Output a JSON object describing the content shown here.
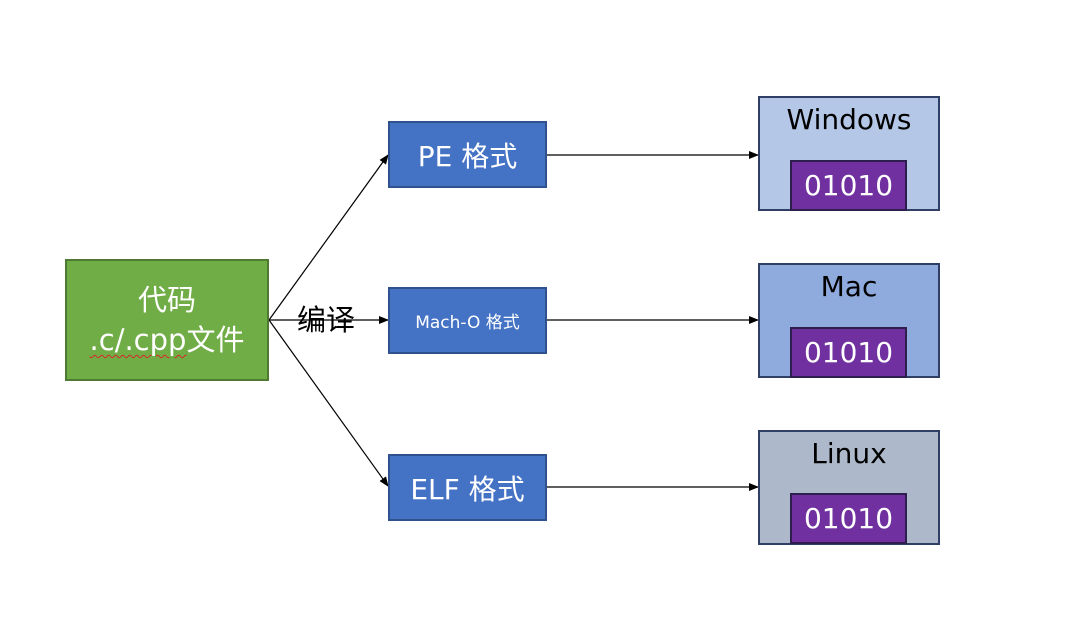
{
  "source": {
    "line1": "代码",
    "line2_ext": ".c/.cpp",
    "line2_suffix": "文件"
  },
  "edge_label": "编译",
  "formats": [
    {
      "label": "PE 格式"
    },
    {
      "label": "Mach-O 格式"
    },
    {
      "label": "ELF 格式"
    }
  ],
  "platforms": [
    {
      "name": "Windows",
      "binary": "01010"
    },
    {
      "name": "Mac",
      "binary": "01010"
    },
    {
      "name": "Linux",
      "binary": "01010"
    }
  ],
  "colors": {
    "source": "#70ad47",
    "format": "#4472c4",
    "windows": "#b4c7e7",
    "mac": "#8faadc",
    "linux": "#adb9ca",
    "binary": "#7030a0"
  }
}
